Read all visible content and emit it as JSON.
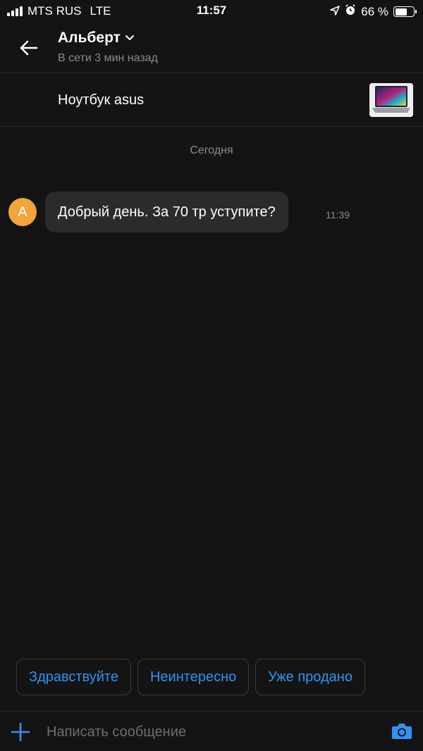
{
  "status_bar": {
    "carrier": "MTS RUS",
    "network": "LTE",
    "time": "11:57",
    "battery_percent": "66 %",
    "battery_level": 0.66
  },
  "header": {
    "contact_name": "Альберт",
    "contact_status": "В сети 3 мин назад"
  },
  "item": {
    "title": "Ноутбук asus"
  },
  "chat": {
    "date_separator": "Сегодня",
    "messages": [
      {
        "avatar_letter": "А",
        "text": "Добрый день. За 70 тр уступите?",
        "time": "11:39"
      }
    ]
  },
  "quick_replies": [
    "Здравствуйте",
    "Неинтересно",
    "Уже продано"
  ],
  "composer": {
    "placeholder": "Написать сообщение"
  },
  "icons": {
    "back": "arrow-left-icon",
    "dropdown": "chevron-down-icon",
    "add": "plus-icon",
    "camera": "camera-icon",
    "location": "location-arrow-icon",
    "alarm": "alarm-icon"
  },
  "colors": {
    "background": "#141414",
    "accent": "#2f93f5",
    "avatar": "#f1a53a",
    "bubble": "#2b2b2d",
    "secondary_text": "#8a8a8e"
  }
}
